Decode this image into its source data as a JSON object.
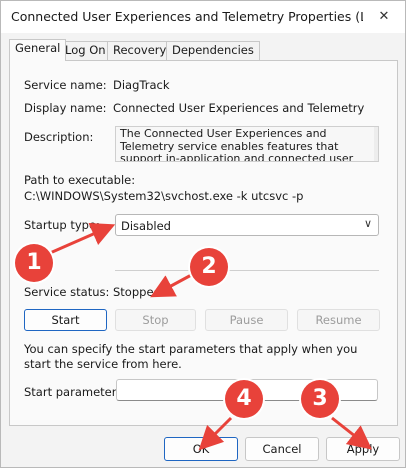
{
  "window": {
    "title": "Connected User Experiences and Telemetry Properties (Local Comp..."
  },
  "tabs": [
    "General",
    "Log On",
    "Recovery",
    "Dependencies"
  ],
  "general": {
    "service_name_label": "Service name:",
    "service_name_value": "DiagTrack",
    "display_name_label": "Display name:",
    "display_name_value": "Connected User Experiences and Telemetry",
    "description_label": "Description:",
    "description_value": "The Connected User Experiences and Telemetry service enables features that support in-application and connected user experiences. Additionally, this",
    "path_label": "Path to executable:",
    "path_value": "C:\\WINDOWS\\System32\\svchost.exe -k utcsvc -p",
    "startup_type_label": "Startup type:",
    "startup_type_value": "Disabled",
    "service_status_label": "Service status:",
    "service_status_value": "Stopped",
    "buttons": {
      "start": "Start",
      "stop": "Stop",
      "pause": "Pause",
      "resume": "Resume"
    },
    "help_text": "You can specify the start parameters that apply when you start the service from here.",
    "start_params_label": "Start parameters:",
    "start_params_value": ""
  },
  "footer": {
    "ok": "OK",
    "cancel": "Cancel",
    "apply": "Apply"
  },
  "annotations": {
    "color": "#e8423a",
    "badges": [
      "1",
      "2",
      "3",
      "4"
    ]
  }
}
